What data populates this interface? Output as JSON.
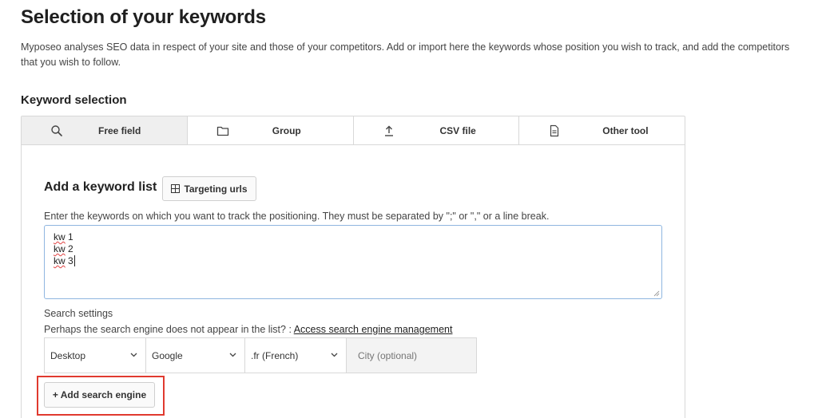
{
  "page": {
    "title": "Selection of your keywords",
    "intro": "Myposeo analyses SEO data in respect of your site and those of your competitors. Add or import here the keywords whose position you wish to track, and add the competitors that you wish to follow."
  },
  "keyword_selection": {
    "title": "Keyword selection",
    "tabs": [
      {
        "label": "Free field",
        "icon": "search-icon",
        "active": true
      },
      {
        "label": "Group",
        "icon": "folder-icon",
        "active": false
      },
      {
        "label": "CSV file",
        "icon": "upload-icon",
        "active": false
      },
      {
        "label": "Other tool",
        "icon": "document-icon",
        "active": false
      }
    ]
  },
  "add_list": {
    "title": "Add a keyword list",
    "targeting_button": "Targeting urls",
    "instructions": "Enter the keywords on which you want to track the positioning. They must be separated by \";\" or \",\" or a line break.",
    "keywords": [
      {
        "word": "kw",
        "num": "1"
      },
      {
        "word": "kw",
        "num": "2"
      },
      {
        "word": "kw",
        "num": "3"
      }
    ]
  },
  "search_settings": {
    "label": "Search settings",
    "hint": "Perhaps the search engine does not appear in the list? : ",
    "link": "Access search engine management",
    "device": "Desktop",
    "engine": "Google",
    "locale": ".fr (French)",
    "city_placeholder": "City (optional)",
    "add_button": "+ Add search engine"
  },
  "colors": {
    "highlight": "#e03a2f",
    "textarea_focus": "#8fb6e0",
    "active_tab": "#efefef"
  }
}
